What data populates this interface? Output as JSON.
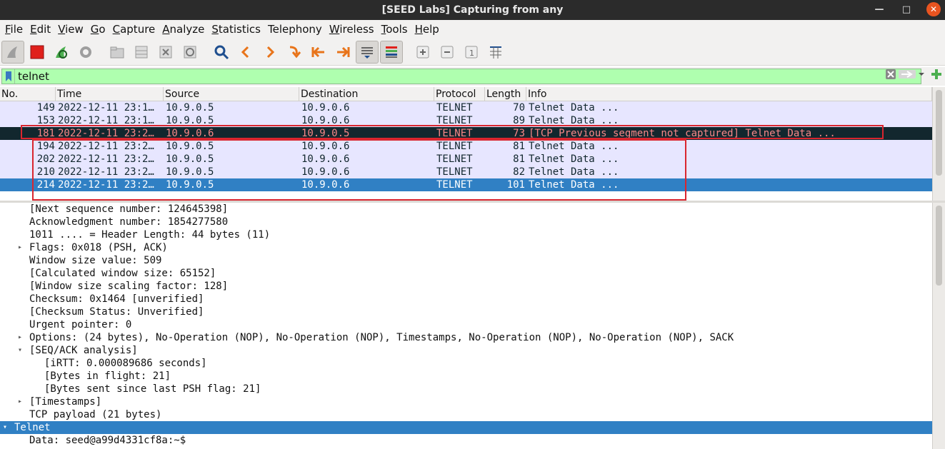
{
  "window": {
    "title": "[SEED Labs] Capturing from any"
  },
  "menu": [
    {
      "label": "File",
      "u": "F",
      "rest": "ile"
    },
    {
      "label": "Edit",
      "u": "E",
      "rest": "dit"
    },
    {
      "label": "View",
      "u": "V",
      "rest": "iew"
    },
    {
      "label": "Go",
      "u": "G",
      "rest": "o"
    },
    {
      "label": "Capture",
      "u": "C",
      "rest": "apture"
    },
    {
      "label": "Analyze",
      "u": "A",
      "rest": "nalyze"
    },
    {
      "label": "Statistics",
      "u": "S",
      "rest": "tatistics"
    },
    {
      "label": "Telephony",
      "u": "",
      "rest": "Telephony"
    },
    {
      "label": "Wireless",
      "u": "W",
      "rest": "ireless"
    },
    {
      "label": "Tools",
      "u": "T",
      "rest": "ools"
    },
    {
      "label": "Help",
      "u": "H",
      "rest": "elp"
    }
  ],
  "filter": {
    "value": "telnet",
    "color": "#afffaf"
  },
  "columns": [
    "No.",
    "Time",
    "Source",
    "Destination",
    "Protocol",
    "Length",
    "Info"
  ],
  "packets": [
    {
      "no": "149",
      "time": "2022-12-11 23:1…",
      "src": "10.9.0.5",
      "dst": "10.9.0.6",
      "proto": "TELNET",
      "len": "70",
      "info": "Telnet Data ..."
    },
    {
      "no": "153",
      "time": "2022-12-11 23:1…",
      "src": "10.9.0.5",
      "dst": "10.9.0.6",
      "proto": "TELNET",
      "len": "89",
      "info": "Telnet Data ..."
    },
    {
      "no": "181",
      "time": "2022-12-11 23:2…",
      "src": "10.9.0.6",
      "dst": "10.9.0.5",
      "proto": "TELNET",
      "len": "73",
      "info": "[TCP Previous segment not captured] Telnet Data ..."
    },
    {
      "no": "194",
      "time": "2022-12-11 23:2…",
      "src": "10.9.0.5",
      "dst": "10.9.0.6",
      "proto": "TELNET",
      "len": "81",
      "info": "Telnet Data ..."
    },
    {
      "no": "202",
      "time": "2022-12-11 23:2…",
      "src": "10.9.0.5",
      "dst": "10.9.0.6",
      "proto": "TELNET",
      "len": "81",
      "info": "Telnet Data ..."
    },
    {
      "no": "210",
      "time": "2022-12-11 23:2…",
      "src": "10.9.0.5",
      "dst": "10.9.0.6",
      "proto": "TELNET",
      "len": "82",
      "info": "Telnet Data ..."
    },
    {
      "no": "214",
      "time": "2022-12-11 23:2…",
      "src": "10.9.0.5",
      "dst": "10.9.0.6",
      "proto": "TELNET",
      "len": "101",
      "info": "Telnet Data ..."
    }
  ],
  "details": [
    {
      "text": "[Next sequence number: 124645398]",
      "arrow": ""
    },
    {
      "text": "Acknowledgment number: 1854277580",
      "arrow": ""
    },
    {
      "text": "1011 .... = Header Length: 44 bytes (11)",
      "arrow": ""
    },
    {
      "text": "Flags: 0x018 (PSH, ACK)",
      "arrow": "right"
    },
    {
      "text": "Window size value: 509",
      "arrow": ""
    },
    {
      "text": "[Calculated window size: 65152]",
      "arrow": ""
    },
    {
      "text": "[Window size scaling factor: 128]",
      "arrow": ""
    },
    {
      "text": "Checksum: 0x1464 [unverified]",
      "arrow": ""
    },
    {
      "text": "[Checksum Status: Unverified]",
      "arrow": ""
    },
    {
      "text": "Urgent pointer: 0",
      "arrow": ""
    },
    {
      "text": "Options: (24 bytes), No-Operation (NOP), No-Operation (NOP), Timestamps, No-Operation (NOP), No-Operation (NOP), SACK",
      "arrow": "right"
    },
    {
      "text": "[SEQ/ACK analysis]",
      "arrow": "down"
    },
    {
      "text": "[iRTT: 0.000089686 seconds]",
      "arrow": "",
      "indent": 1
    },
    {
      "text": "[Bytes in flight: 21]",
      "arrow": "",
      "indent": 1
    },
    {
      "text": "[Bytes sent since last PSH flag: 21]",
      "arrow": "",
      "indent": 1
    },
    {
      "text": "[Timestamps]",
      "arrow": "right"
    },
    {
      "text": "TCP payload (21 bytes)",
      "arrow": ""
    },
    {
      "text": "Telnet",
      "arrow": "down",
      "top": true
    },
    {
      "text": "Data: seed@a99d4331cf8a:~$",
      "arrow": ""
    }
  ]
}
